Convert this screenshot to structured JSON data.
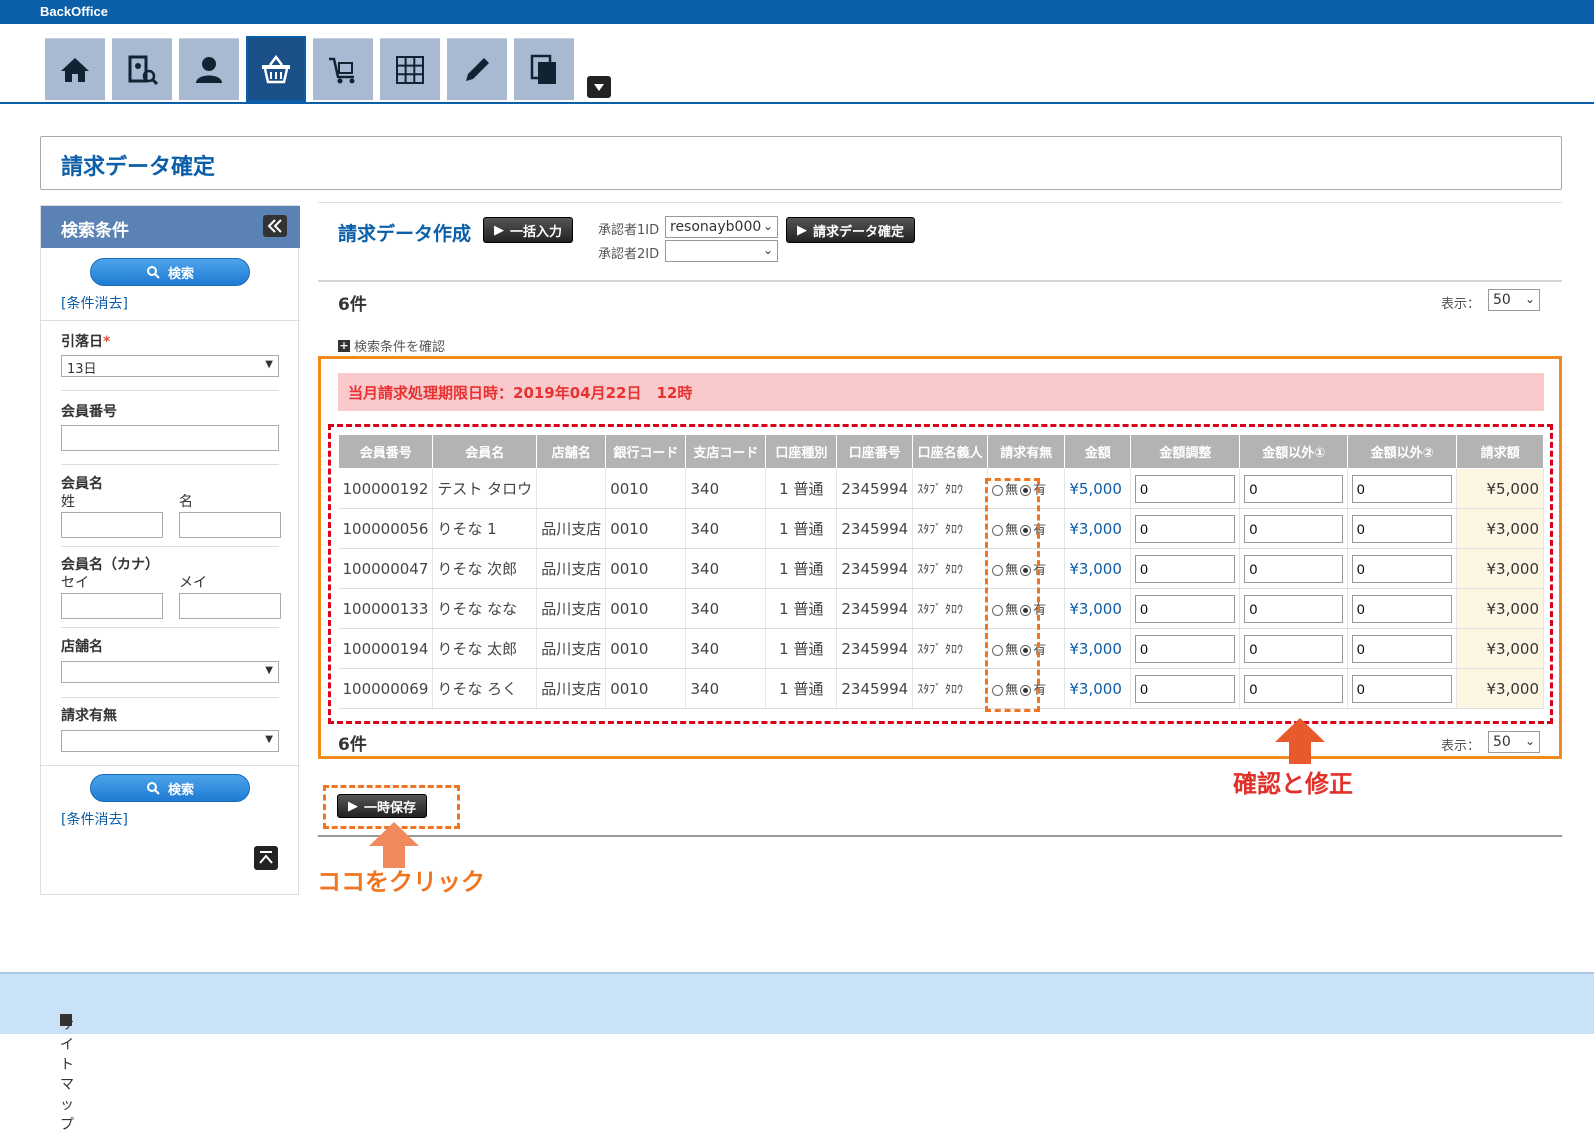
{
  "app": {
    "brand": "BackOffice"
  },
  "nav": {
    "items": [
      {
        "name": "home-icon"
      },
      {
        "name": "member-search-icon"
      },
      {
        "name": "user-icon"
      },
      {
        "name": "basket-icon",
        "active": true
      },
      {
        "name": "cart-icon"
      },
      {
        "name": "grid-icon"
      },
      {
        "name": "pencil-icon"
      },
      {
        "name": "documents-icon"
      }
    ]
  },
  "page": {
    "title": "請求データ確定"
  },
  "sidebar": {
    "title": "検索条件",
    "search_label": "検索",
    "clear_label": "[条件消去]",
    "debit_date_label": "引落日",
    "required_mark": "*",
    "debit_date_value": "13日",
    "member_no_label": "会員番号",
    "member_name_label": "会員名",
    "last_name_label": "姓",
    "first_name_label": "名",
    "member_kana_label": "会員名（カナ）",
    "last_kana_label": "セイ",
    "first_kana_label": "メイ",
    "store_label": "店舗名",
    "billing_label": "請求有無"
  },
  "main": {
    "title": "請求データ作成",
    "bulk_input_label": "一括入力",
    "approver1_label": "承認者1ID",
    "approver1_value": "resonayb000",
    "approver2_label": "承認者2ID",
    "approver2_value": "",
    "confirm_label": "請求データ確定",
    "count_top": "6件",
    "count_bottom": "6件",
    "display_label": "表示：",
    "display_value": "50",
    "conditions_toggle": "検索条件を確認",
    "alert": "当月請求処理期限日時：2019年04月22日　12時",
    "save_label": "一時保存"
  },
  "table": {
    "headers": [
      "会員番号",
      "会員名",
      "店舗名",
      "銀行コード",
      "支店コード",
      "口座種別",
      "口座番号",
      "口座名義人",
      "請求有無",
      "金額",
      "金額調整",
      "金額以外①",
      "金額以外②",
      "請求額"
    ],
    "rows": [
      {
        "member_no": "100000192",
        "name": "テスト タロウ",
        "store": "",
        "bank": "0010",
        "branch": "340",
        "type": "1 普通",
        "account": "2345994",
        "holder": "ｽﾀﾌﾞ ﾀﾛｳ",
        "no": "無",
        "yes": "有",
        "amount": "¥5,000",
        "adj": "0",
        "other1": "0",
        "other2": "0",
        "total": "¥5,000"
      },
      {
        "member_no": "100000056",
        "name": "りそな 1",
        "store": "品川支店",
        "bank": "0010",
        "branch": "340",
        "type": "1 普通",
        "account": "2345994",
        "holder": "ｽﾀﾌﾞ ﾀﾛｳ",
        "no": "無",
        "yes": "有",
        "amount": "¥3,000",
        "adj": "0",
        "other1": "0",
        "other2": "0",
        "total": "¥3,000"
      },
      {
        "member_no": "100000047",
        "name": "りそな 次郎",
        "store": "品川支店",
        "bank": "0010",
        "branch": "340",
        "type": "1 普通",
        "account": "2345994",
        "holder": "ｽﾀﾌﾞ ﾀﾛｳ",
        "no": "無",
        "yes": "有",
        "amount": "¥3,000",
        "adj": "0",
        "other1": "0",
        "other2": "0",
        "total": "¥3,000"
      },
      {
        "member_no": "100000133",
        "name": "りそな なな",
        "store": "品川支店",
        "bank": "0010",
        "branch": "340",
        "type": "1 普通",
        "account": "2345994",
        "holder": "ｽﾀﾌﾞ ﾀﾛｳ",
        "no": "無",
        "yes": "有",
        "amount": "¥3,000",
        "adj": "0",
        "other1": "0",
        "other2": "0",
        "total": "¥3,000"
      },
      {
        "member_no": "100000194",
        "name": "りそな 太郎",
        "store": "品川支店",
        "bank": "0010",
        "branch": "340",
        "type": "1 普通",
        "account": "2345994",
        "holder": "ｽﾀﾌﾞ ﾀﾛｳ",
        "no": "無",
        "yes": "有",
        "amount": "¥3,000",
        "adj": "0",
        "other1": "0",
        "other2": "0",
        "total": "¥3,000"
      },
      {
        "member_no": "100000069",
        "name": "りそな ろく",
        "store": "品川支店",
        "bank": "0010",
        "branch": "340",
        "type": "1 普通",
        "account": "2345994",
        "holder": "ｽﾀﾌﾞ ﾀﾛｳ",
        "no": "無",
        "yes": "有",
        "amount": "¥3,000",
        "adj": "0",
        "other1": "0",
        "other2": "0",
        "total": "¥3,000"
      }
    ]
  },
  "annotations": {
    "click_here": "ココをクリック",
    "check_fix": "確認と修正"
  },
  "footer": {
    "sitemap": "サイトマップ"
  },
  "colors": {
    "brand_blue": "#0b5ea8",
    "orange": "#f08a1c",
    "red": "#d9001b",
    "callout_orange": "#f07521"
  }
}
